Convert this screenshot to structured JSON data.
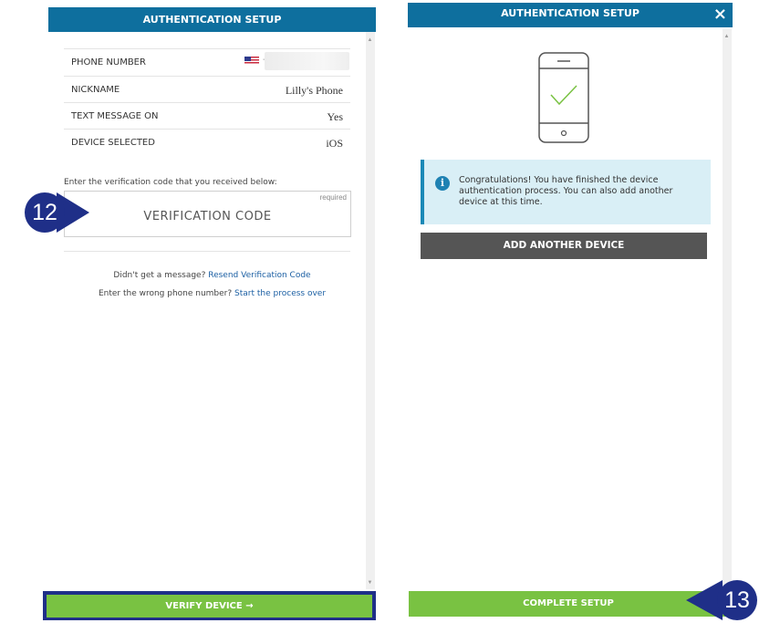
{
  "left_panel": {
    "title": "AUTHENTICATION SETUP",
    "rows": [
      {
        "label": "PHONE NUMBER",
        "value": "-"
      },
      {
        "label": "NICKNAME",
        "value": "Lilly's Phone"
      },
      {
        "label": "TEXT MESSAGE ON",
        "value": "Yes"
      },
      {
        "label": "DEVICE SELECTED",
        "value": "iOS"
      }
    ],
    "instruction": "Enter the verification code that you received below:",
    "code_field": {
      "placeholder": "VERIFICATION CODE",
      "required_label": "required"
    },
    "resend_prompt": "Didn't get a message?",
    "resend_link": "Resend Verification Code",
    "restart_prompt": "Enter the wrong phone number?",
    "restart_link": "Start the process over",
    "verify_button": "VERIFY DEVICE",
    "verify_arrow": "→"
  },
  "right_panel": {
    "title": "AUTHENTICATION SETUP",
    "close": "×",
    "alert_text": "Congratulations! You have finished the device authentication process. You can also add another device at this time.",
    "alert_icon": "i",
    "add_button": "ADD ANOTHER DEVICE",
    "complete_button": "COMPLETE SETUP"
  },
  "callouts": {
    "step_a": "12",
    "step_b": "13"
  },
  "colors": {
    "header": "#0e6f9e",
    "green": "#79c242",
    "callout": "#1f2f88",
    "alert_bg": "#d9eff6",
    "gray_button": "#555555"
  }
}
